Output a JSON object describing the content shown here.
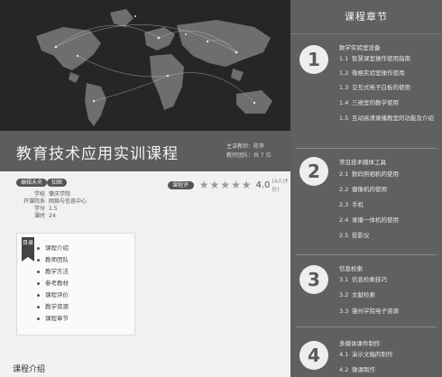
{
  "course": {
    "title": "教育技术应用实训课程",
    "teacher_line1": "主讲教师：陈萍",
    "teacher_line2": "教师团队：共 7 位",
    "tag_primary": "编辑未央",
    "tag_secondary": "知图",
    "meta": [
      {
        "key": "学校",
        "value": "肇庆学院"
      },
      {
        "key": "开课院系",
        "value": "网络与信息中心"
      },
      {
        "key": "学分",
        "value": "1.5"
      },
      {
        "key": "课时",
        "value": "24"
      }
    ],
    "rating_label": "课程评价",
    "stars": "★★★★★",
    "score": "4.0",
    "rating_count": "(4人评价)"
  },
  "toc": {
    "badge": "目录",
    "items": [
      "课程介绍",
      "教师团队",
      "教学方法",
      "参考教材",
      "课程评价",
      "教学资源",
      "课程章节"
    ]
  },
  "section_heading": "课程介绍",
  "chapters_panel": {
    "title": "课程章节",
    "chapters": [
      {
        "num": "1",
        "title": "数学实验室设备",
        "lessons": [
          {
            "num": "1.1",
            "text": "智慧课室操作使用指南"
          },
          {
            "num": "1.2",
            "text": "微格实验室操作使用"
          },
          {
            "num": "1.3",
            "text": "交互式电子白板的使用"
          },
          {
            "num": "1.4",
            "text": "三维室的教学使用"
          },
          {
            "num": "1.5",
            "text": "互动高清录播教室的功能及介绍"
          }
        ]
      },
      {
        "num": "2",
        "title": "常见技术媒体工具",
        "lessons": [
          {
            "num": "2.1",
            "text": "数码照相机的使用"
          },
          {
            "num": "2.2",
            "text": "摄像机的使用"
          },
          {
            "num": "2.3",
            "text": "手机"
          },
          {
            "num": "2.4",
            "text": "录播一体机的使用"
          },
          {
            "num": "2.5",
            "text": "投影仪"
          }
        ]
      },
      {
        "num": "3",
        "title": "信息检索",
        "lessons": [
          {
            "num": "3.1",
            "text": "信息检索技巧"
          },
          {
            "num": "3.2",
            "text": "文献检索"
          },
          {
            "num": "3.3",
            "text": "肇州学院电子资源"
          }
        ]
      },
      {
        "num": "4",
        "title": "多媒体课件制作",
        "lessons": [
          {
            "num": "4.1",
            "text": "演示文稿的制作"
          },
          {
            "num": "4.2",
            "text": "微课制作"
          }
        ]
      }
    ]
  },
  "colors": {
    "panel_bg": "#606060",
    "hero_bg": "#2b2b2b",
    "badge_bg": "#555555",
    "circle_bg": "#eeeeee"
  }
}
